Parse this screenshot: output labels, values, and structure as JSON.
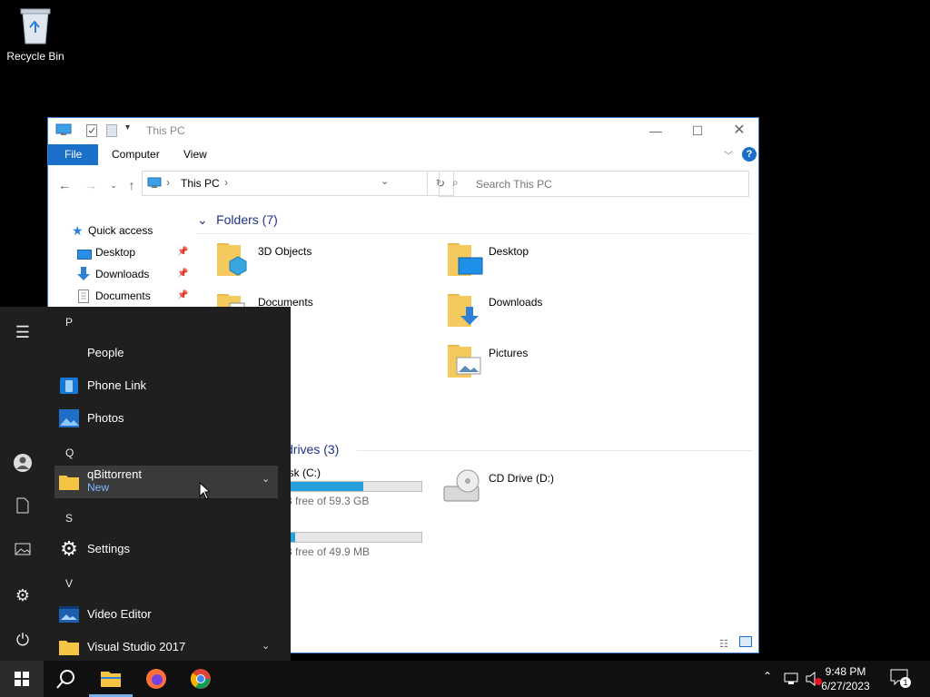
{
  "desktop": {
    "recycle_bin_label": "Recycle Bin"
  },
  "explorer": {
    "title": "This PC",
    "ribbon_tabs": [
      "File",
      "Computer",
      "View"
    ],
    "address": {
      "crumb": "This PC"
    },
    "search_placeholder": "Search This PC",
    "nav_pane": {
      "quick_access": "Quick access",
      "items": [
        {
          "label": "Desktop",
          "icon": "desktop-icon"
        },
        {
          "label": "Downloads",
          "icon": "download-arrow-icon"
        },
        {
          "label": "Documents",
          "icon": "documents-icon"
        }
      ]
    },
    "folders_header": "Folders (7)",
    "folders": [
      {
        "label": "3D Objects",
        "icon": "3d-objects-folder-icon"
      },
      {
        "label": "Desktop",
        "icon": "desktop-folder-icon"
      },
      {
        "label": "Documents",
        "icon": "documents-folder-icon"
      },
      {
        "label": "Downloads",
        "icon": "downloads-folder-icon"
      },
      {
        "label": "Pictures",
        "icon": "pictures-folder-icon"
      }
    ],
    "drives_header": "drives (3)",
    "drives": [
      {
        "label": "isk (C:)",
        "free_text": "3 free of 59.3 GB",
        "used_fraction": 0.57
      },
      {
        "label": "",
        "free_text": "3 free of 49.9 MB",
        "used_fraction": 0.06
      },
      {
        "label": "CD Drive (D:)",
        "free_text": ""
      }
    ]
  },
  "start_menu": {
    "sections": [
      {
        "letter": "P",
        "apps": [
          "People",
          "Phone Link",
          "Photos"
        ]
      },
      {
        "letter": "Q",
        "apps": [
          "qBittorrent"
        ]
      },
      {
        "letter": "S",
        "apps": [
          "Settings"
        ]
      },
      {
        "letter": "V",
        "apps": [
          "Video Editor",
          "Visual Studio 2017"
        ]
      }
    ],
    "qbittorrent_badge": "New"
  },
  "taskbar": {
    "time": "9:48 PM",
    "date": "6/27/2023",
    "notification_count": "1"
  },
  "colors": {
    "accent": "#1a6fc9",
    "start_bg": "#1f1f1f",
    "taskbar_bg": "#101010"
  }
}
